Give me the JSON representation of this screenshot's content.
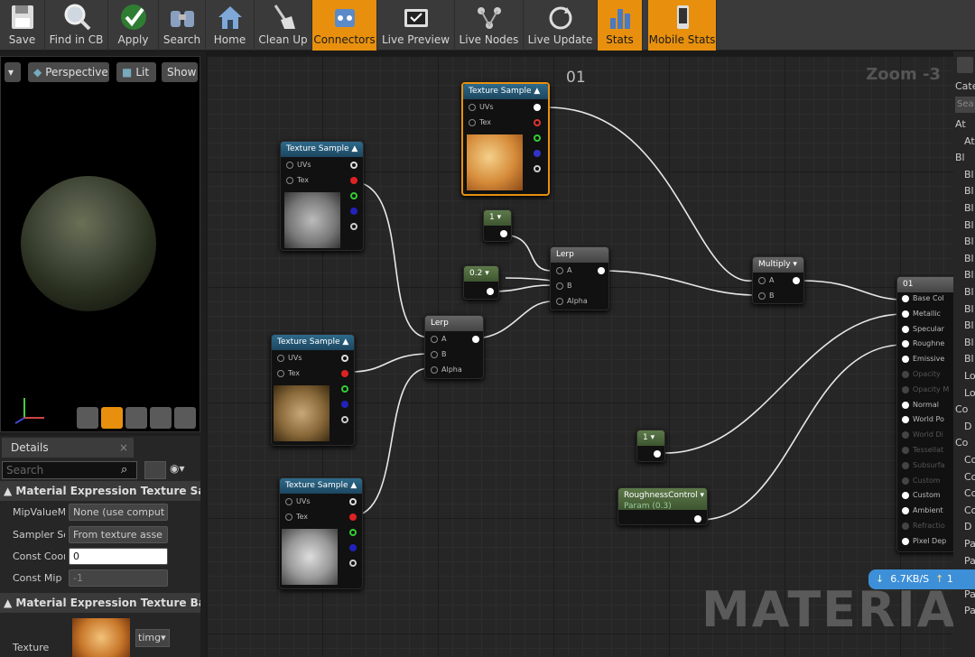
{
  "toolbar": {
    "save": "Save",
    "find_in_cb": "Find in CB",
    "apply": "Apply",
    "search": "Search",
    "home": "Home",
    "clean_up": "Clean Up",
    "connectors": "Connectors",
    "live_preview": "Live Preview",
    "live_nodes": "Live Nodes",
    "live_update": "Live Update",
    "stats": "Stats",
    "mobile_stats": "Mobile Stats"
  },
  "viewport": {
    "perspective": "Perspective",
    "lit": "Lit",
    "show": "Show"
  },
  "details": {
    "tab": "Details",
    "search_placeholder": "Search",
    "section1": "Material Expression Texture Samp",
    "rows": [
      {
        "label": "MipValueM",
        "value": "None (use comput"
      },
      {
        "label": "Sampler So",
        "value": "From texture asse"
      },
      {
        "label": "Const Coor",
        "value": "0"
      },
      {
        "label": "Const Mip",
        "value": "-1"
      }
    ],
    "section2": "Material Expression Texture Base",
    "texture_label": "Texture",
    "texture_value": "timg"
  },
  "graph": {
    "title": "01",
    "zoom": "Zoom -3",
    "watermark": "MATERIAL",
    "nodes": {
      "tex_top": {
        "title": "Texture Sample",
        "uvs": "UVs",
        "tex": "Tex"
      },
      "tex1": {
        "title": "Texture Sample",
        "uvs": "UVs",
        "tex": "Tex"
      },
      "tex2": {
        "title": "Texture Sample",
        "uvs": "UVs",
        "tex": "Tex"
      },
      "tex3": {
        "title": "Texture Sample",
        "uvs": "UVs",
        "tex": "Tex"
      },
      "const1": {
        "title": "1"
      },
      "const02": {
        "title": "0.2"
      },
      "const1b": {
        "title": "1"
      },
      "lerp1": {
        "title": "Lerp",
        "a": "A",
        "b": "B",
        "alpha": "Alpha"
      },
      "lerp2": {
        "title": "Lerp",
        "a": "A",
        "b": "B",
        "alpha": "Alpha"
      },
      "multiply": {
        "title": "Multiply",
        "a": "A",
        "b": "B"
      },
      "rough": {
        "title": "RoughnessControl",
        "sub": "Param (0.3)"
      },
      "result": {
        "title": "01",
        "pins": [
          "Base Col",
          "Metallic",
          "Specular",
          "Roughne",
          "Emissive",
          "Opacity",
          "Opacity M",
          "Normal",
          "World Po",
          "World Di",
          "Tessellat",
          "Subsurfa",
          "Custom",
          "Custom",
          "Ambient",
          "Refractio",
          "Pixel Dep"
        ]
      }
    }
  },
  "right_panel": {
    "cate": "Cate",
    "search": "Sea",
    "items": [
      "At",
      "At",
      "Bl",
      "Bl",
      "Bl",
      "Bl",
      "Bl",
      "Bl",
      "Bl",
      "Bl",
      "Bl",
      "Bl",
      "Bl",
      "Bl",
      "Bl",
      "Lo",
      "Lo",
      "Co",
      "D",
      "Co",
      "Co",
      "Co",
      "Co",
      "Co",
      "D",
      "Pa",
      "Pa",
      "Pa",
      "Pa",
      "Pa"
    ]
  },
  "network": {
    "down": "6.7KB/S",
    "up": "1"
  }
}
